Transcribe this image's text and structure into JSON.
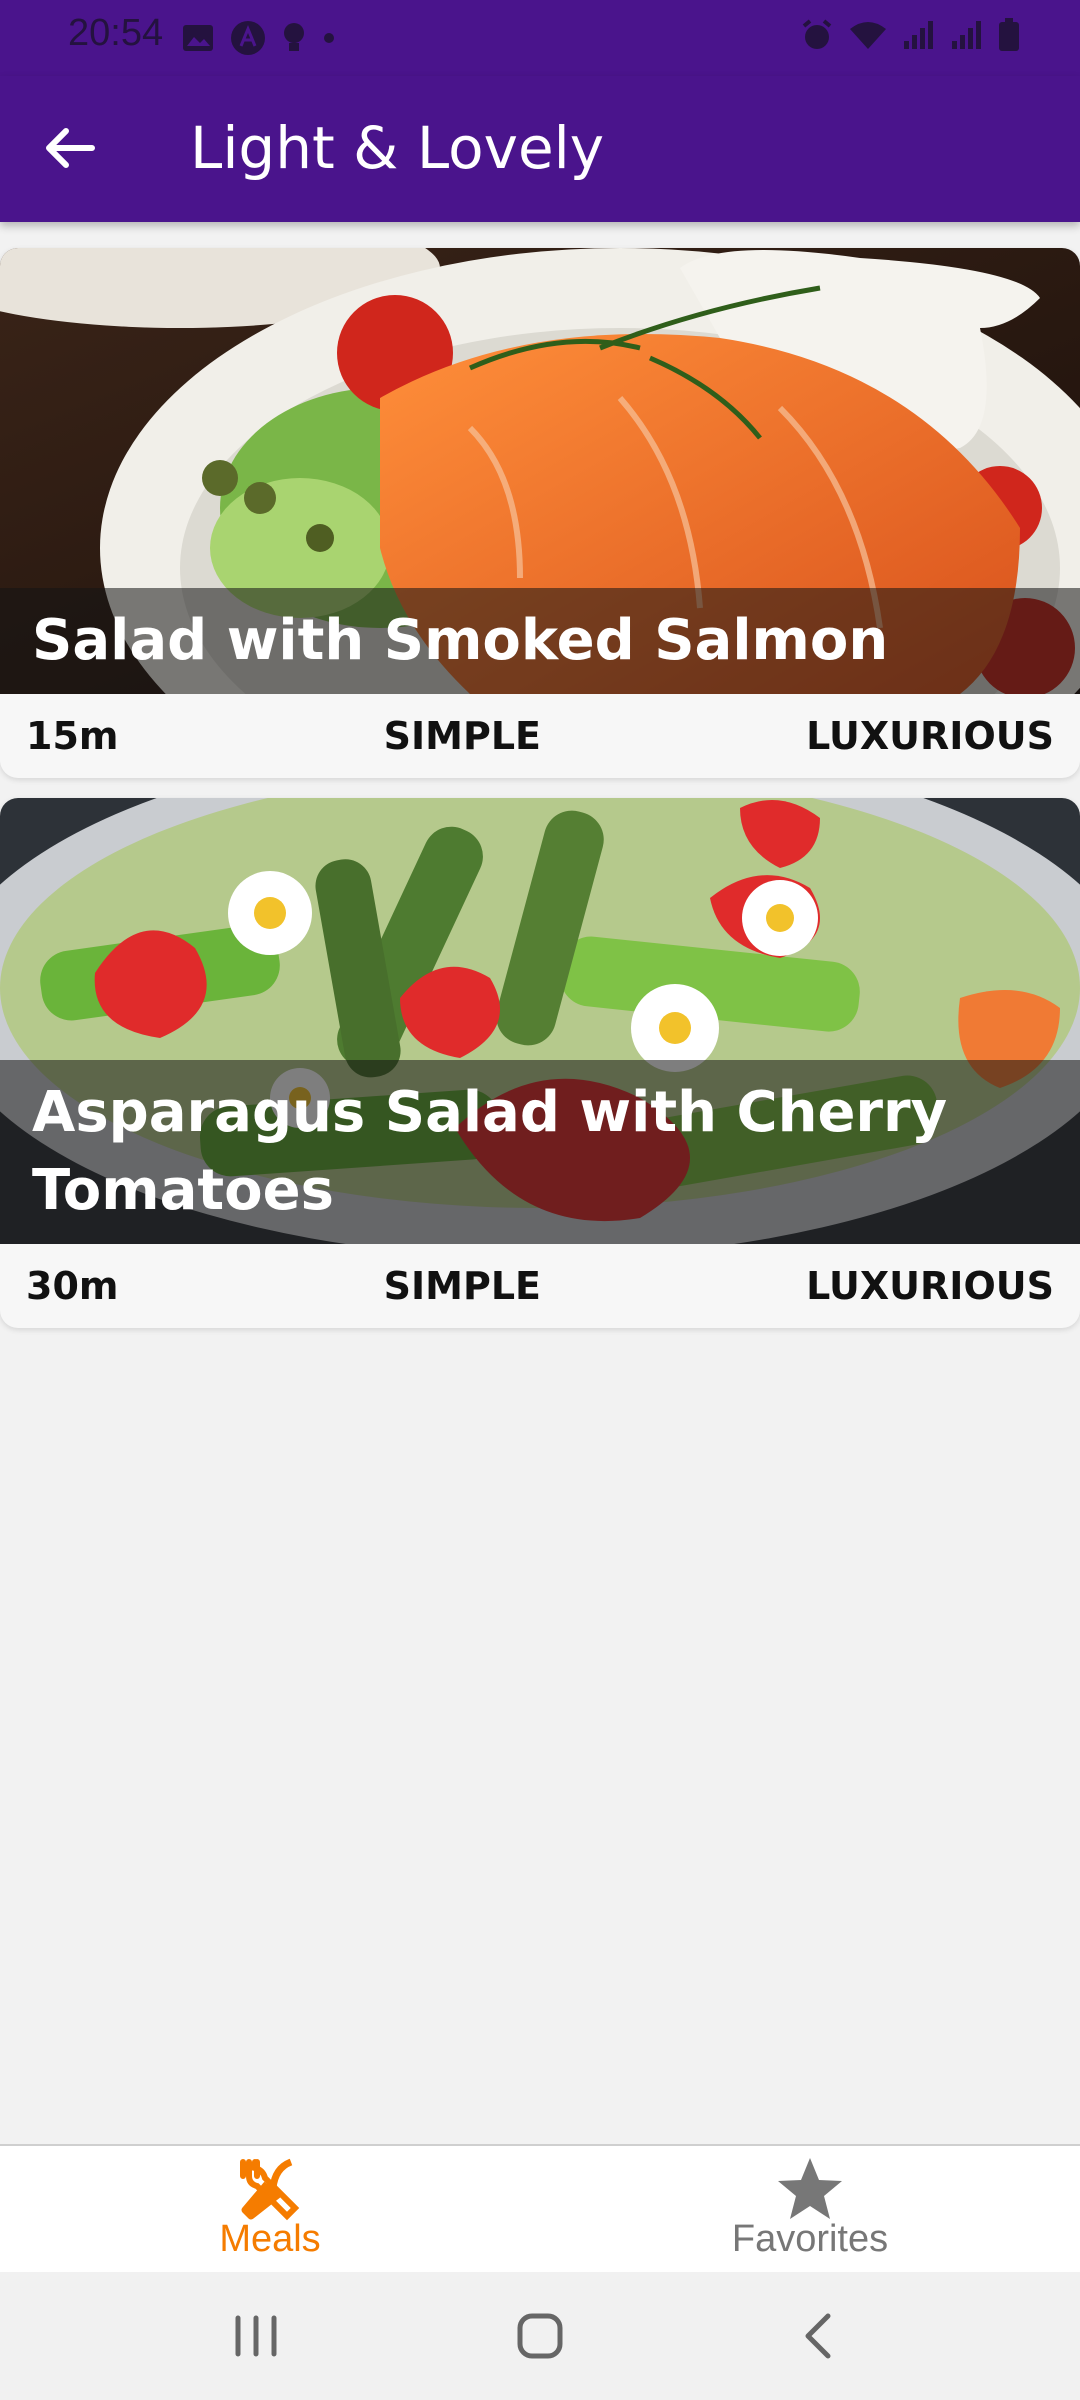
{
  "status_bar": {
    "time": "20:54",
    "left_icons": [
      "image-icon",
      "a-circle-icon",
      "bulb-icon",
      "dot-icon"
    ],
    "right_icons": [
      "alarm-icon",
      "wifi-icon",
      "signal-icon",
      "signal-icon",
      "battery-icon"
    ]
  },
  "app_bar": {
    "title": "Light & Lovely",
    "color": "#4a148c"
  },
  "meals": [
    {
      "title": "Salad with Smoked Salmon",
      "duration": "15m",
      "complexity": "SIMPLE",
      "affordability": "LUXURIOUS"
    },
    {
      "title": "Asparagus Salad with Cherry Tomatoes",
      "duration": "30m",
      "complexity": "SIMPLE",
      "affordability": "LUXURIOUS"
    }
  ],
  "bottom_nav": {
    "items": [
      {
        "label": "Meals",
        "icon": "fork-knife-icon",
        "active": true,
        "color": "#f57c00"
      },
      {
        "label": "Favorites",
        "icon": "star-icon",
        "active": false,
        "color": "#777777"
      }
    ]
  },
  "system_nav": [
    "recent-apps-icon",
    "home-icon",
    "back-icon"
  ]
}
